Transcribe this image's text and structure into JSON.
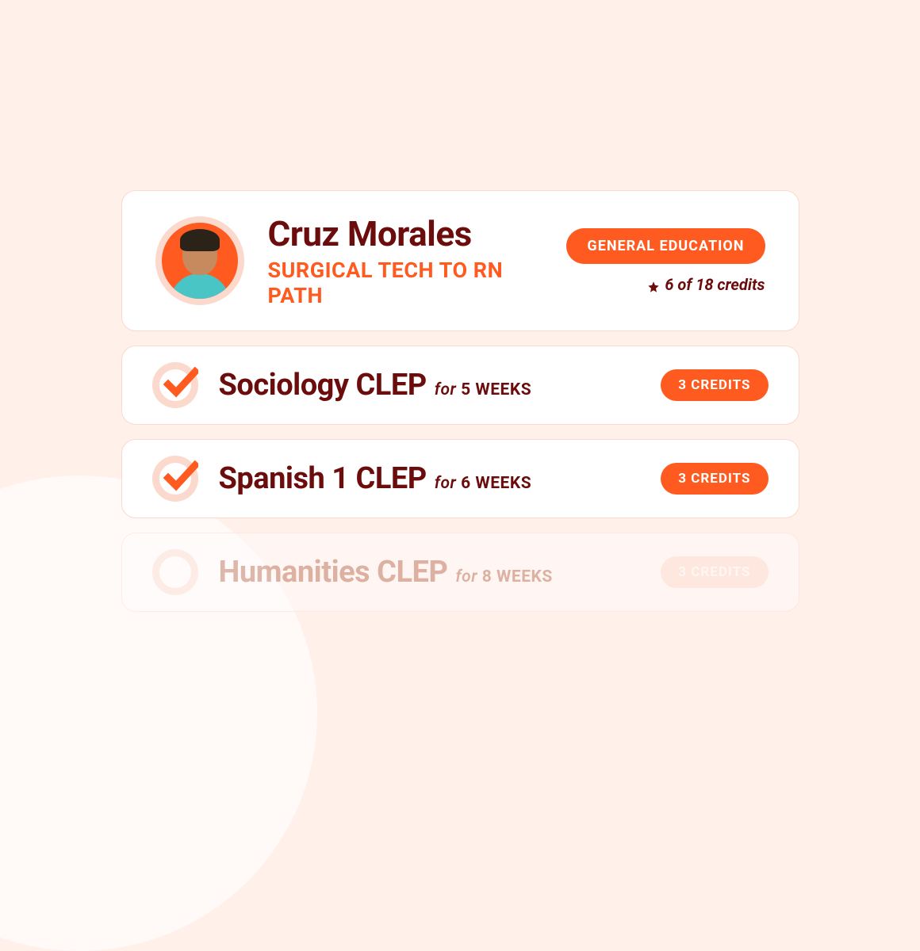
{
  "colors": {
    "accent": "#FF5A1F",
    "text_dark": "#6B0D0D",
    "bg": "#FFF0EA",
    "card_border": "#FBD9CC"
  },
  "student": {
    "name": "Cruz Morales",
    "path": "SURGICAL TECH TO RN PATH",
    "category_badge": "GENERAL EDUCATION",
    "progress_text": "6 of 18 credits"
  },
  "courses": [
    {
      "title": "Sociology CLEP",
      "for_word": "for",
      "duration": "5 WEEKS",
      "credits_label": "3 CREDITS",
      "completed": true
    },
    {
      "title": "Spanish 1 CLEP",
      "for_word": "for",
      "duration": "6 WEEKS",
      "credits_label": "3 CREDITS",
      "completed": true
    },
    {
      "title": "Humanities CLEP",
      "for_word": "for",
      "duration": "8 WEEKS",
      "credits_label": "3 CREDITS",
      "completed": false
    }
  ]
}
